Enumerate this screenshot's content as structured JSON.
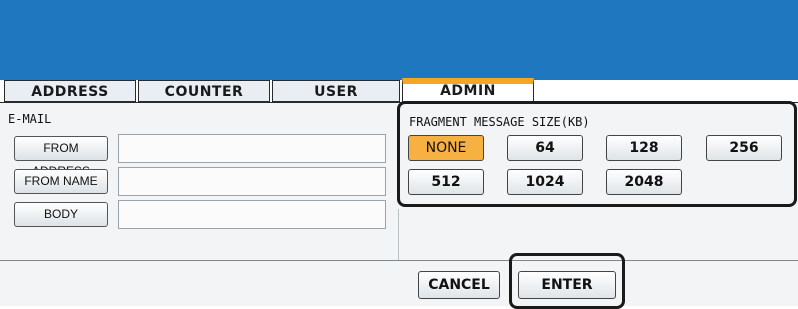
{
  "tabs": [
    {
      "label": "ADDRESS"
    },
    {
      "label": "COUNTER"
    },
    {
      "label": "USER"
    },
    {
      "label": "ADMIN"
    }
  ],
  "email": {
    "section_label": "E-MAIL",
    "from_address_label": "FROM ADDRESS",
    "from_address_value": "",
    "from_name_label": "FROM NAME",
    "from_name_value": "",
    "body_label": "BODY",
    "body_value": ""
  },
  "fragment": {
    "title": "FRAGMENT MESSAGE SIZE(KB)",
    "options": [
      "NONE",
      "64",
      "128",
      "256",
      "512",
      "1024",
      "2048"
    ],
    "selected": "NONE"
  },
  "footer": {
    "cancel_label": "CANCEL",
    "enter_label": "ENTER"
  },
  "colors": {
    "header": "#1f78bf",
    "accent": "#f6a623",
    "selected": "#f7b042"
  }
}
